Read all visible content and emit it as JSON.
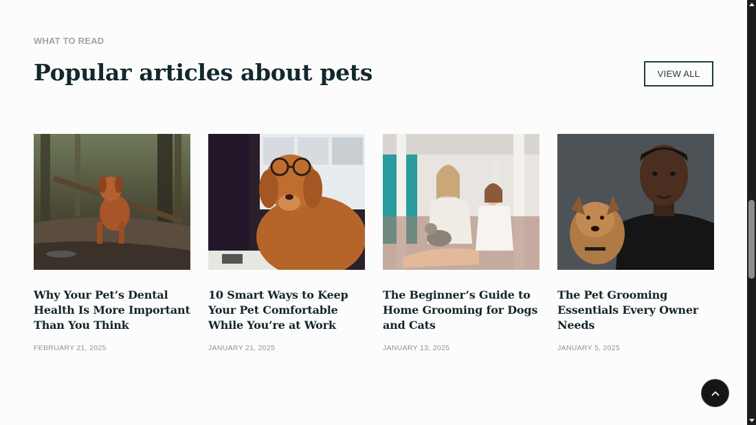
{
  "section": {
    "eyebrow": "WHAT TO READ",
    "title": "Popular articles about pets",
    "view_all_label": "VIEW ALL"
  },
  "articles": [
    {
      "title": "Why Your Pet’s Dental Health Is More Important Than You Think",
      "date": "FEBRUARY 21, 2025",
      "image": "dog-with-stick-in-forest"
    },
    {
      "title": "10 Smart Ways to Keep Your Pet Comfortable While You’re at Work",
      "date": "JANUARY 21, 2025",
      "image": "dog-wearing-glasses"
    },
    {
      "title": "The Beginner’s Guide to Home Grooming for Dogs and Cats",
      "date": "JANUARY 13, 2025",
      "image": "woman-and-child-with-cat"
    },
    {
      "title": "The Pet Grooming Essentials Every Owner Needs",
      "date": "JANUARY 5, 2025",
      "image": "man-holding-small-dog"
    }
  ],
  "controls": {
    "back_to_top_icon": "chevron-up-icon"
  },
  "colors": {
    "heading": "#13282e",
    "eyebrow": "#9aa3ab",
    "button_border": "#1c3a40",
    "background": "#fdfcfd"
  }
}
